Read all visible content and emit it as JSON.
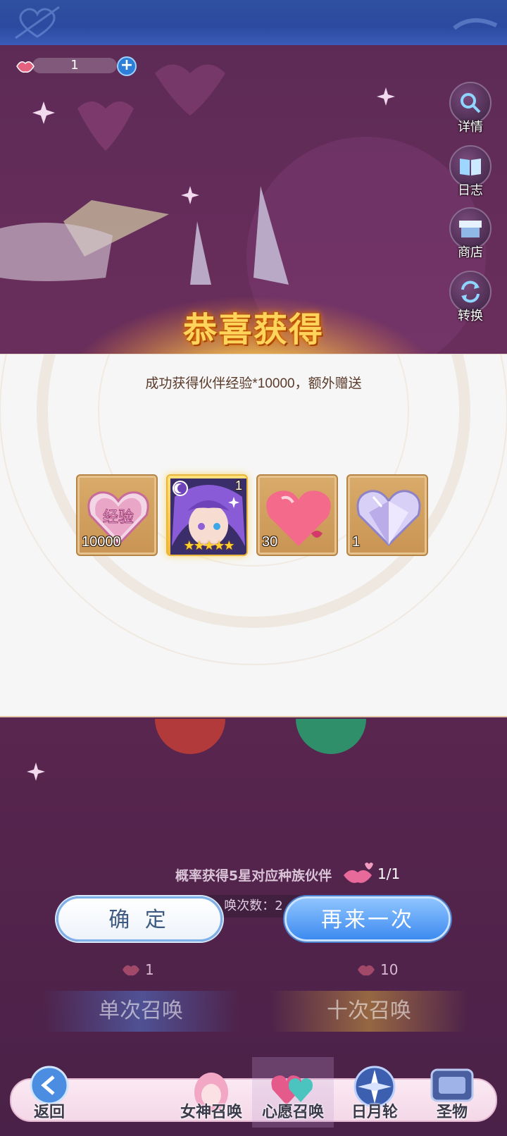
{
  "header": {
    "currency_value": "1"
  },
  "side_menu": [
    {
      "key": "details",
      "label": "详情",
      "icon": "magnifier-icon"
    },
    {
      "key": "log",
      "label": "日志",
      "icon": "book-icon"
    },
    {
      "key": "shop",
      "label": "商店",
      "icon": "shop-icon"
    },
    {
      "key": "convert",
      "label": "转换",
      "icon": "refresh-icon"
    }
  ],
  "dialog": {
    "title": "恭喜获得",
    "description": "成功获得伙伴经验*10000，额外赠送",
    "rewards": [
      {
        "name": "经验",
        "count": "10000",
        "icon": "exp-heart-crystal-icon"
      },
      {
        "name": "hero",
        "count": "1",
        "stars": "★★★★★",
        "icon": "hero-portrait-icon"
      },
      {
        "name": "pink-heart",
        "count": "30",
        "icon": "pink-heart-icon"
      },
      {
        "name": "crystal-heart",
        "count": "1",
        "icon": "crystal-heart-icon"
      }
    ],
    "confirm_label": "确 定",
    "again_label": "再来一次"
  },
  "summon": {
    "info_text": "概率获得5星对应种族伙伴",
    "kiss_count": "1/1",
    "sub_text": "唤次数：2",
    "single_cost": "1",
    "ten_cost": "10",
    "single_label": "单次召唤",
    "ten_label": "十次召唤"
  },
  "nav": {
    "back": "返回",
    "goddess": "女神召唤",
    "wish": "心愿召唤",
    "sunmoon": "日月轮",
    "relic": "圣物"
  },
  "colors": {
    "title_gold": "#ffd45a",
    "confirm_blue": "#7fb0e8",
    "again_blue": "#3d8bf0",
    "panel_bg": "#f6f6f6",
    "page_bg": "#5b2a55"
  }
}
